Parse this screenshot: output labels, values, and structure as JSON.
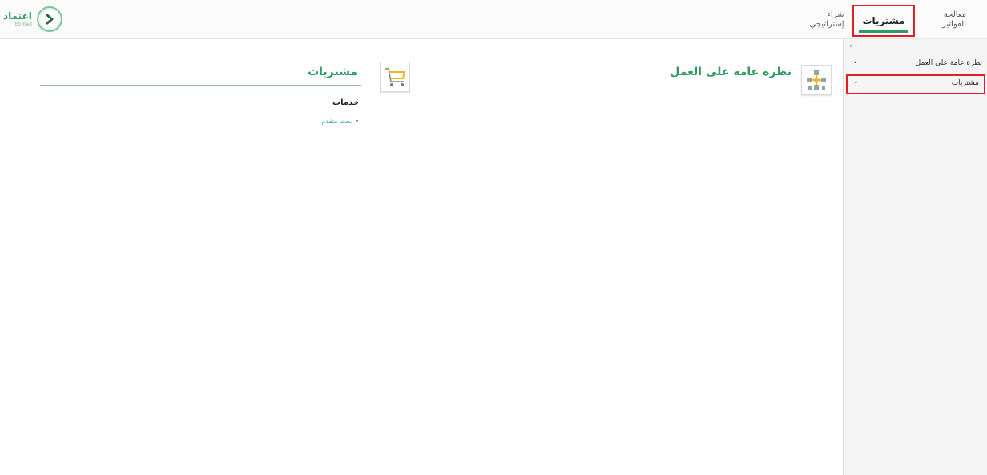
{
  "logo": {
    "arabic": "اعتماد",
    "latin": "Etimad"
  },
  "tabs": [
    {
      "label": "معالجة الفواتير"
    },
    {
      "label": "مشتريات"
    },
    {
      "label": "شراء إستراتيجي"
    }
  ],
  "sidebar": {
    "collapse_glyph": "›",
    "items": [
      {
        "label": "نظرة عامة على العمل"
      },
      {
        "label": "مشتريات"
      }
    ]
  },
  "main": {
    "work_overview_title": "نظرة عامة على العمل",
    "purchases_title": "مشتريات",
    "services_label": "خدمات",
    "advanced_search_link": "بحث متقدم"
  },
  "colors": {
    "accent": "#2f9a63",
    "highlight": "#e31e24",
    "cart_yellow": "#f2b51c"
  }
}
